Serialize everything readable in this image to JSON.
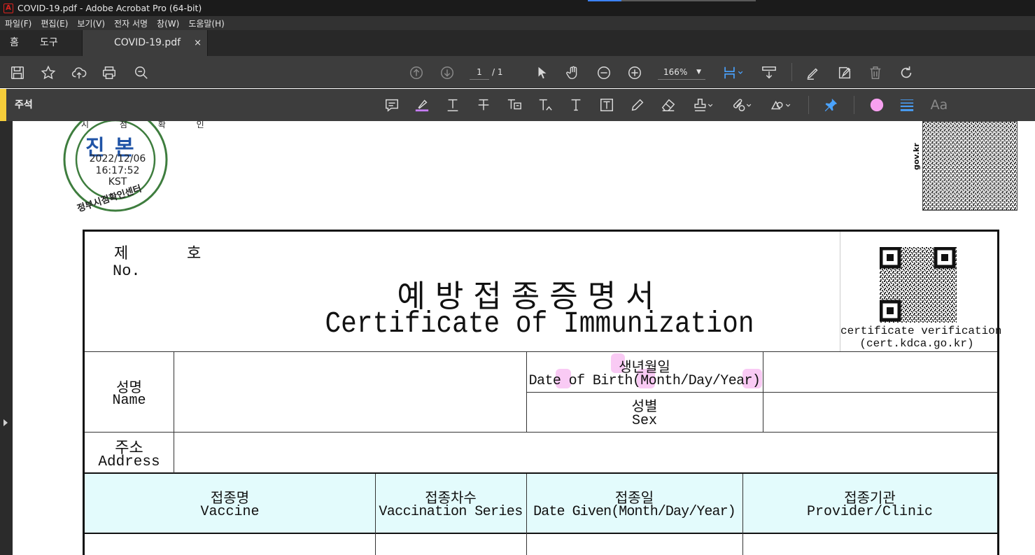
{
  "window": {
    "title": "COVID-19.pdf - Adobe Acrobat Pro (64-bit)"
  },
  "menu": [
    "파일(F)",
    "편집(E)",
    "보기(V)",
    "전자 서명",
    "창(W)",
    "도움말(H)"
  ],
  "tabs": {
    "home": "홈",
    "tools": "도구",
    "document": "COVID-19.pdf",
    "close": "×"
  },
  "toolbar": {
    "page_current": "1",
    "page_total": "/ 1",
    "zoom": "166%"
  },
  "comment_toolbar": {
    "title": "주석",
    "text_properties": "Aa",
    "accent_color": "#f7a0f0"
  },
  "colors": {
    "highlight": "#f7b8f0",
    "table_header": "#e3fbfc",
    "accent_bar": "#f5cd3a"
  },
  "stamp": {
    "title": "진 본",
    "date": "2022/12/06",
    "time": "16:17:52",
    "zone": "KST",
    "arc_top": "시 점 확 인",
    "arc_bottom": "정부시점확인센터"
  },
  "side_label": "gov.kr",
  "certificate": {
    "no_ko": "제",
    "no_ko2": "호",
    "no_en": "No.",
    "title_ko": "예 방 접 종 증 명 서",
    "title_en": "Certificate of Immunization",
    "verify_line1": "certificate verification",
    "verify_line2": "(cert.kdca.go.kr)",
    "name_ko": "성명",
    "name_en": "Name",
    "dob_ko": "생년월일",
    "dob_en": "Date of Birth(Month/Day/Year)",
    "sex_ko": "성별",
    "sex_en": "Sex",
    "address_ko": "주소",
    "address_en": "Address",
    "columns": [
      {
        "ko": "접종명",
        "en": "Vaccine"
      },
      {
        "ko": "접종차수",
        "en": "Vaccination Series"
      },
      {
        "ko": "접종일",
        "en": "Date Given(Month/Day/Year)"
      },
      {
        "ko": "접종기관",
        "en": "Provider/Clinic"
      }
    ]
  }
}
